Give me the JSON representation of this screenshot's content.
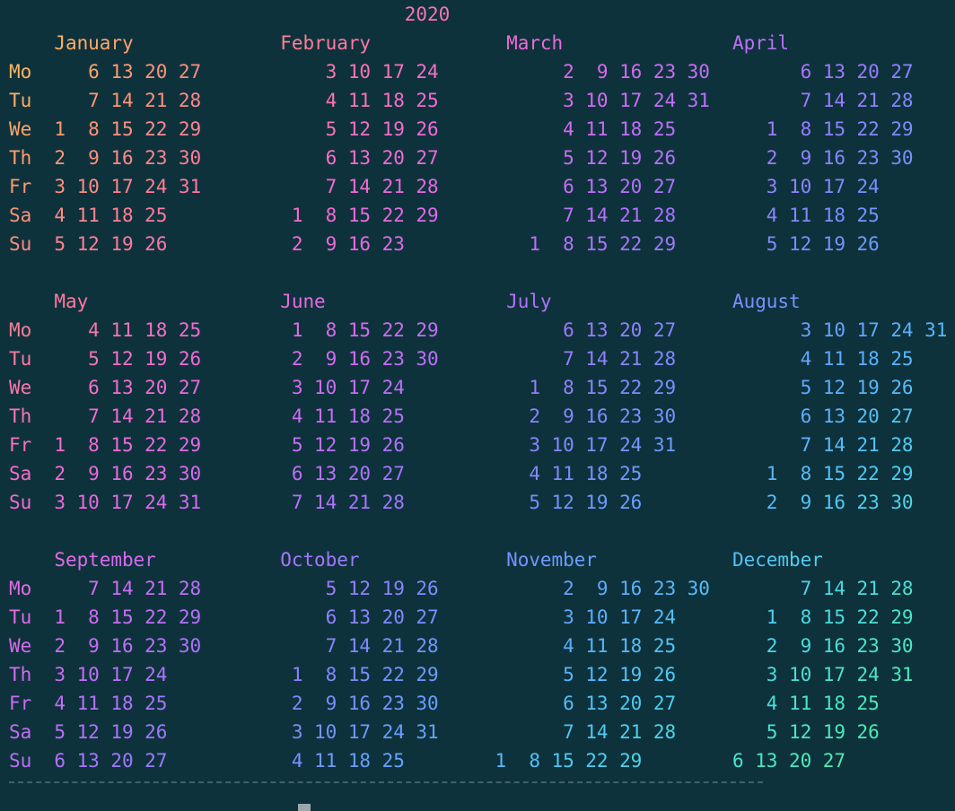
{
  "terminal": {
    "background": "#0e323c",
    "palette": [
      "#ffc35a",
      "#ff9a6e",
      "#ff7a9a",
      "#f56ad2",
      "#d46af2",
      "#a774ff",
      "#7c8cff",
      "#5eaaff",
      "#4dd0f0",
      "#4ae6c8",
      "#54f08e"
    ],
    "rows": [
      "                                   2020",
      "    January             February            March               April",
      "Mo     6 13 20 27           3 10 17 24           2  9 16 23 30        6 13 20 27",
      "Tu     7 14 21 28           4 11 18 25           3 10 17 24 31        7 14 21 28",
      "We  1  8 15 22 29           5 12 19 26           4 11 18 25        1  8 15 22 29",
      "Th  2  9 16 23 30           6 13 20 27           5 12 19 26        2  9 16 23 30",
      "Fr  3 10 17 24 31           7 14 21 28           6 13 20 27        3 10 17 24",
      "Sa  4 11 18 25           1  8 15 22 29           7 14 21 28        4 11 18 25",
      "Su  5 12 19 26           2  9 16 23           1  8 15 22 29        5 12 19 26",
      "",
      "    May                 June                July                August",
      "Mo     4 11 18 25        1  8 15 22 29           6 13 20 27           3 10 17 24 31",
      "Tu     5 12 19 26        2  9 16 23 30           7 14 21 28           4 11 18 25",
      "We     6 13 20 27        3 10 17 24           1  8 15 22 29           5 12 19 26",
      "Th     7 14 21 28        4 11 18 25           2  9 16 23 30           6 13 20 27",
      "Fr  1  8 15 22 29        5 12 19 26           3 10 17 24 31           7 14 21 28",
      "Sa  2  9 16 23 30        6 13 20 27           4 11 18 25           1  8 15 22 29",
      "Su  3 10 17 24 31        7 14 21 28           5 12 19 26           2  9 16 23 30",
      "",
      "    September           October             November            December",
      "Mo     7 14 21 28           5 12 19 26           2  9 16 23 30        7 14 21 28",
      "Tu  1  8 15 22 29           6 13 20 27           3 10 17 24        1  8 15 22 29",
      "We  2  9 16 23 30           7 14 21 28           4 11 18 25        2  9 16 23 30",
      "Th  3 10 17 24           1  8 15 22 29           5 12 19 26        3 10 17 24 31",
      "Fr  4 11 18 25           2  9 16 23 30           6 13 20 27        4 11 18 25",
      "Sa  5 12 19 26           3 10 17 24 31           7 14 21 28        5 12 19 26",
      "Su  6 13 20 27           4 11 18 25        1  8 15 22 29        6 13 20 27"
    ]
  }
}
